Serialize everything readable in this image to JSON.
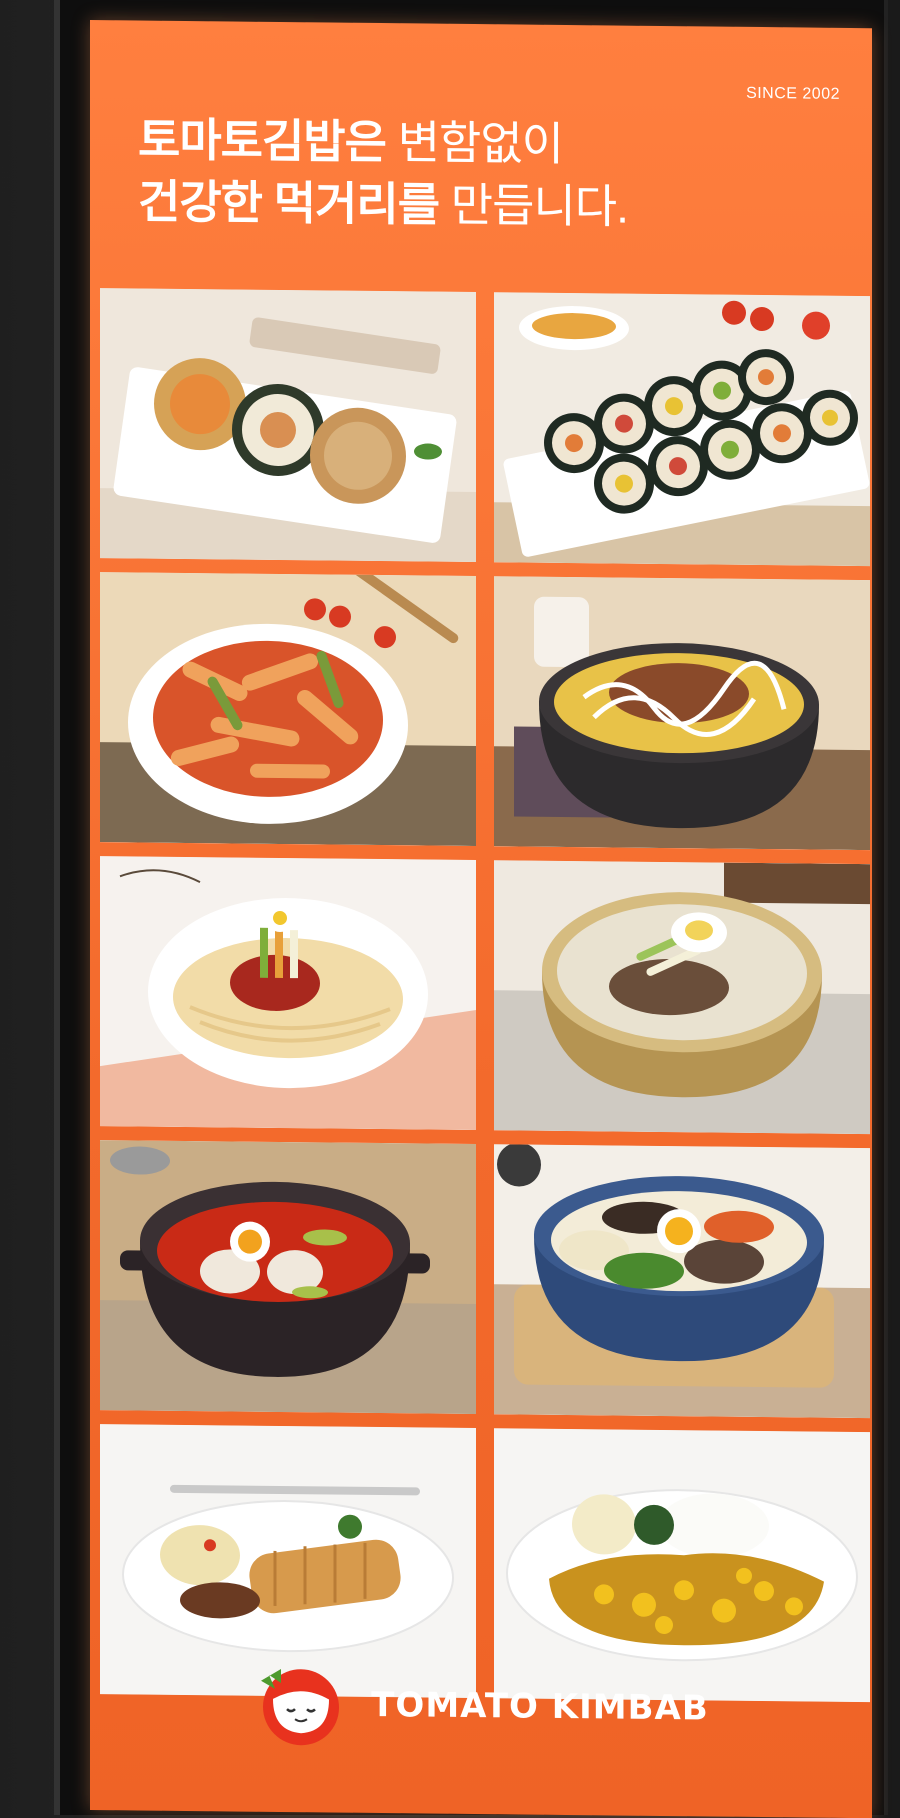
{
  "poster": {
    "since": "SINCE 2002",
    "headline_line1_bold": "토마토김밥은",
    "headline_line1_light": " 변함없이",
    "headline_line2_bold": "건강한 먹거리를",
    "headline_line2_light": " 만듭니다.",
    "brand_name": "TOMATO KIMBAB",
    "background_color": "#f36a2c",
    "text_color": "#ffffff"
  },
  "food_tiles": [
    {
      "dish": "triple-kimbab-rolls"
    },
    {
      "dish": "sliced-kimbab-platter"
    },
    {
      "dish": "tteokbokki-plate"
    },
    {
      "dish": "rice-bowl-with-sauce"
    },
    {
      "dish": "bibim-noodles"
    },
    {
      "dish": "cold-buckwheat-noodles"
    },
    {
      "dish": "spicy-stew-pot"
    },
    {
      "dish": "bibimbap-bowl"
    },
    {
      "dish": "pork-cutlet-plate"
    },
    {
      "dish": "curry-rice-plate"
    }
  ]
}
